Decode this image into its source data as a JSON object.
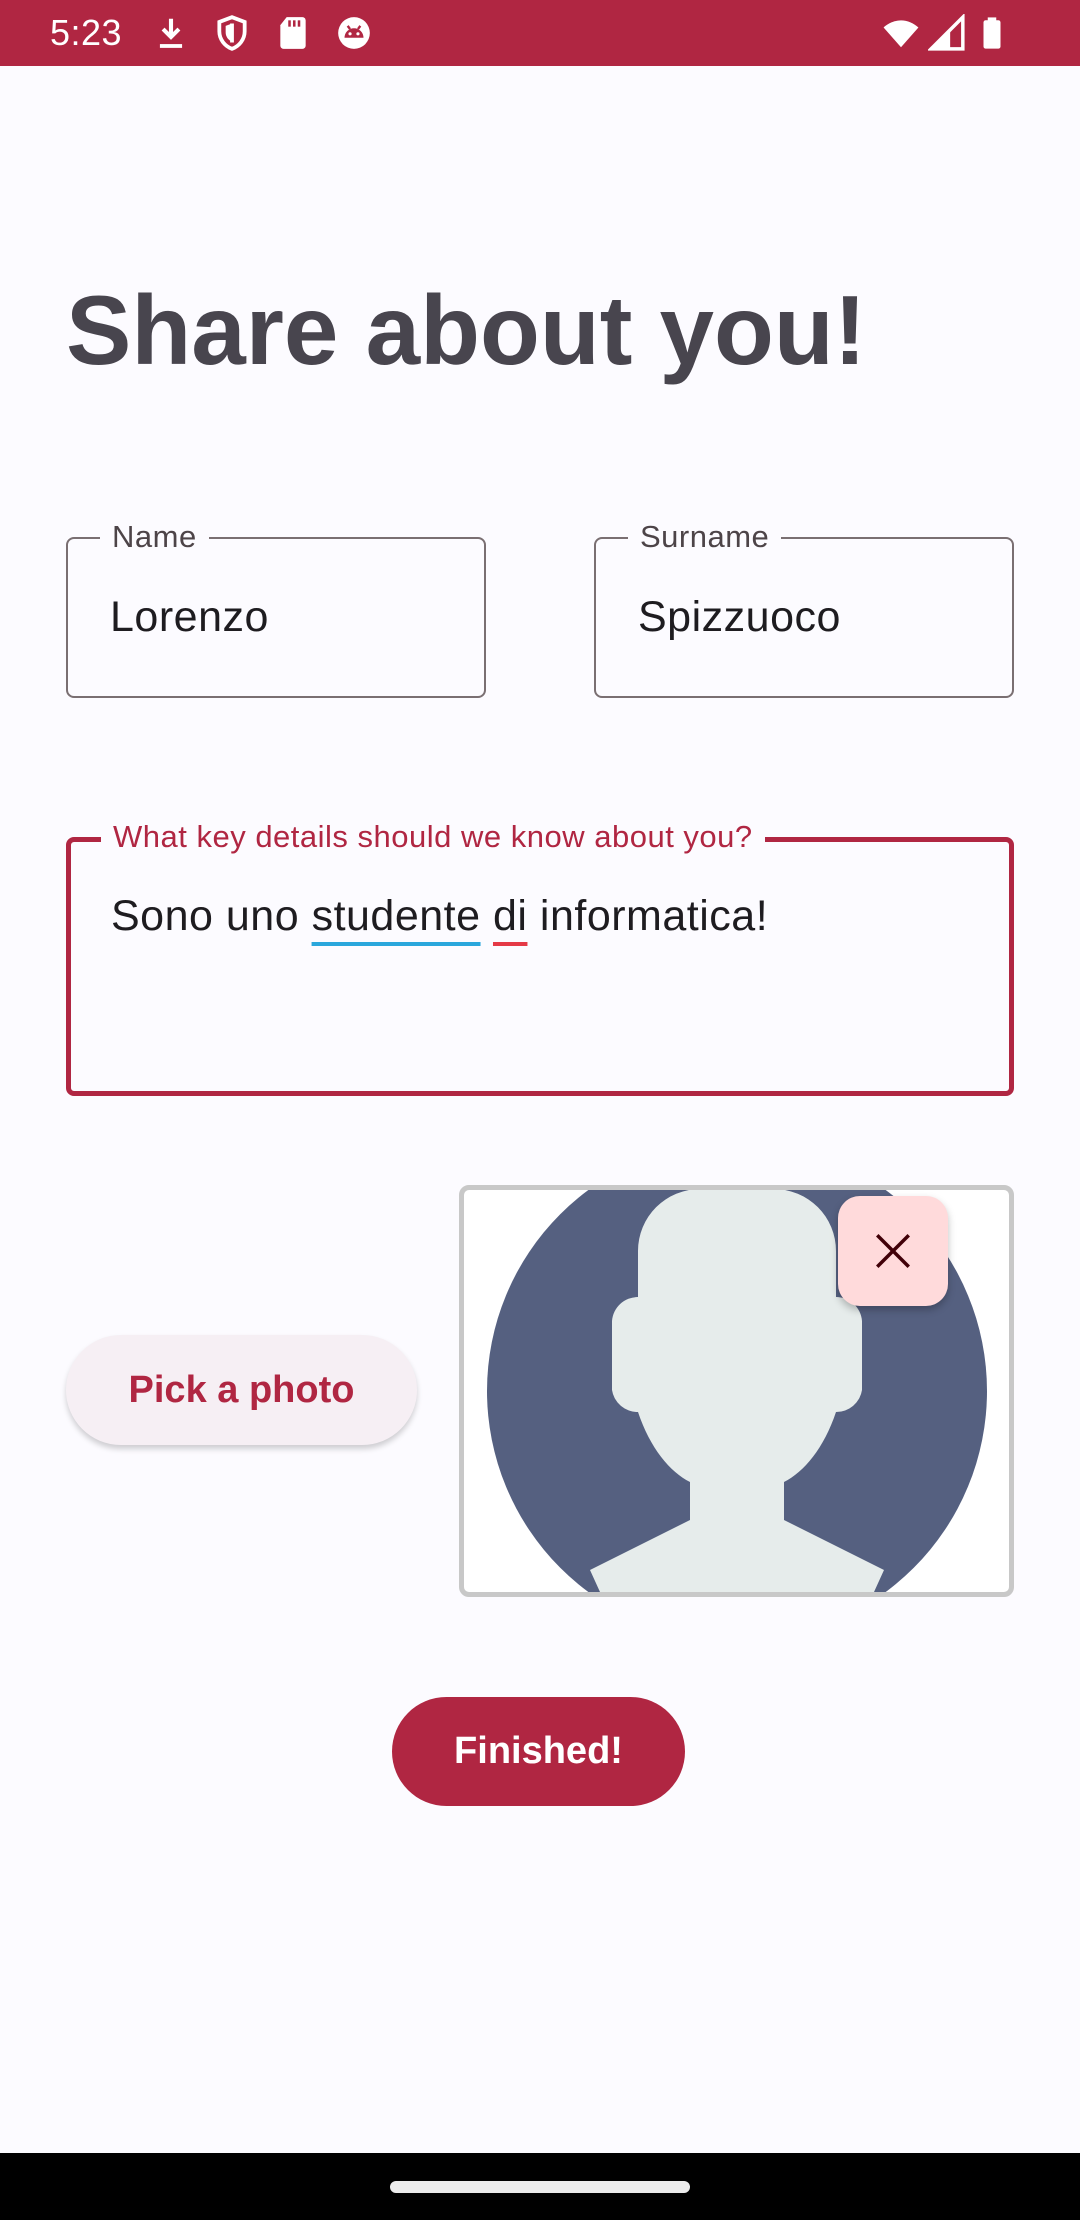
{
  "status_bar": {
    "time": "5:23",
    "left_icons": [
      "download-icon",
      "shield-icon",
      "sd-card-icon",
      "android-debug-icon"
    ],
    "right_icons": [
      "wifi-icon",
      "signal-icon",
      "battery-icon"
    ]
  },
  "title": "Share about you!",
  "form": {
    "name": {
      "label": "Name",
      "value": "Lorenzo"
    },
    "surname": {
      "label": "Surname",
      "value": "Spizzuoco"
    },
    "details": {
      "label": "What key details should we know about you?",
      "value_parts": [
        "Sono uno ",
        "studente",
        " ",
        "di",
        " informatica!"
      ]
    }
  },
  "photo": {
    "pick_label": "Pick a photo",
    "icons": [
      "avatar-placeholder",
      "close-icon"
    ]
  },
  "finish_label": "Finished!",
  "colors": {
    "primary": "#b02642",
    "background": "#fcfbff",
    "tonal_button": "#f6eff4",
    "close_container": "#ffdadb",
    "avatar_circle": "#556080",
    "avatar_silhouette": "#e6eceb"
  }
}
